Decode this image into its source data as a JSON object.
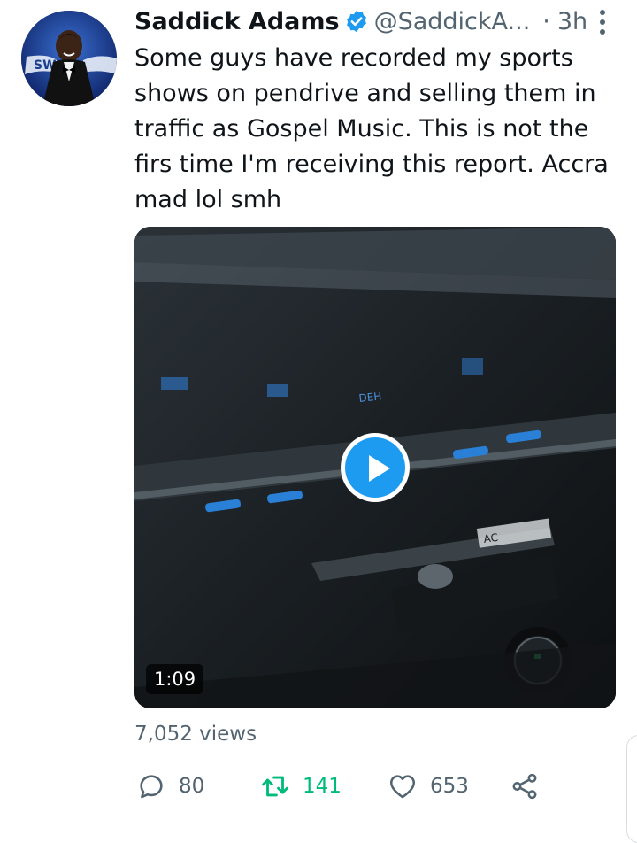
{
  "tweet": {
    "author_name": "Saddick Adams",
    "handle": "@SaddickA...",
    "separator": "·",
    "time": "3h",
    "text": "Some guys have recorded my sports\nshows on pendrive and selling them in\ntraffic as Gospel Music. This is not the\nfirs time I'm receiving this report. Accra\nmad lol smh",
    "avatar_badge_text": "SWAG",
    "colors": {
      "accent": "#1d9bf0",
      "retweet": "#00ba7c",
      "muted": "#536471",
      "text": "#0f1419"
    }
  },
  "video": {
    "duration": "1:09",
    "frame_labels": [
      "DEH",
      "AC"
    ],
    "icons": [
      "play-icon"
    ]
  },
  "stats": {
    "views": "7,052 views",
    "replies": "80",
    "retweets": "141",
    "likes": "653"
  },
  "icons": [
    "verified-badge-icon",
    "more-icon",
    "reply-icon",
    "retweet-icon",
    "like-icon",
    "share-icon"
  ]
}
